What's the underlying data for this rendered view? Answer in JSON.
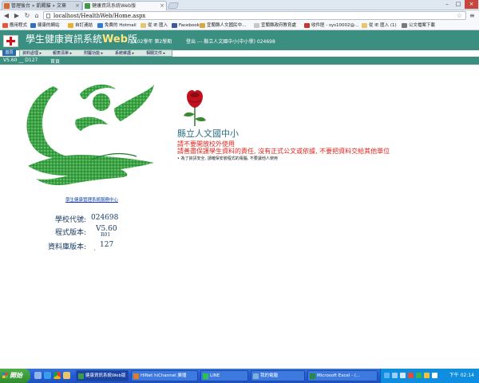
{
  "browser": {
    "tabs": [
      {
        "label": "管理後台 » 凱賜貓 » 文章",
        "color": "#d86a2b",
        "active": false
      },
      {
        "label": "健康資訊系統Web版",
        "color": "#3f9b4a",
        "active": true
      }
    ],
    "url": "localhost/HealthWeb/Home.aspx",
    "bookmarks": [
      {
        "label": "應用程式",
        "color": "#e5573b"
      },
      {
        "label": "健康的網站",
        "color": "#2f6ec7"
      },
      {
        "label": "自訂連結",
        "color": "#e9b12a"
      },
      {
        "label": "免費的 Hotmail",
        "color": "#2f7dd3"
      },
      {
        "label": "從 IE 匯入",
        "color": "#e9c56b"
      },
      {
        "label": "Facebook",
        "color": "#3b5998"
      },
      {
        "label": "宜蘭縣人文國民中…",
        "color": "#d9a83a"
      },
      {
        "label": "宜蘭縣政府教育處",
        "color": "#c7c7c7"
      },
      {
        "label": "收件匣 - sys10002@…",
        "color": "#c9372c"
      },
      {
        "label": "從 IE 匯入 (1)",
        "color": "#e9c56b"
      },
      {
        "label": "公文檔案下載",
        "color": "#7a7a7a"
      }
    ]
  },
  "header": {
    "title_main": "學生健康資訊系統",
    "title_web": "Web",
    "title_suffix": "版",
    "semester": "102學年 第2學期",
    "login": "登出 --- 縣立人文國中小(中小學) 024698",
    "home_badge": "首頁"
  },
  "menu": [
    {
      "label": "資料處理"
    },
    {
      "label": "報表清單"
    },
    {
      "label": "附屬功能"
    },
    {
      "label": "系統維護"
    },
    {
      "label": "相關文件"
    }
  ],
  "status": {
    "version": "V5.60 __ D127",
    "home": "首頁"
  },
  "main": {
    "center_link": "學生健康管理系統服務中心",
    "school_code_label": "學校代號:",
    "school_code": "024698",
    "program_version_label": "程式版本:",
    "program_version": "V5.60",
    "program_sub": "R01",
    "db_version_label": "資料庫版本:",
    "db_version": "127",
    "tick": "'",
    "school_name": "縣立人文國中小",
    "warning1": "請不要開放校外使用",
    "warning2": "請善盡保護學生資料的責任, 沒有正式公文或依據, 不要把資料交給其他單位",
    "security_note": "• 為了資訊安全, 請確保安裝程式的電腦, 不要讓他人使用"
  },
  "taskbar": {
    "start": "開始",
    "tasks": [
      {
        "label": "健康資訊系統Web版",
        "color": "#3f9b4a",
        "active": true
      },
      {
        "label": "HiNet hiChannel 廣播",
        "color": "#e07b2b",
        "active": false
      },
      {
        "label": "LINE",
        "color": "#2fc34a",
        "active": false
      },
      {
        "label": "我的電腦",
        "color": "#7fb0e0",
        "active": false
      },
      {
        "label": "Microsoft Excel - (…",
        "color": "#2a8a3a",
        "active": false
      }
    ],
    "clock": "下午 02:14"
  }
}
